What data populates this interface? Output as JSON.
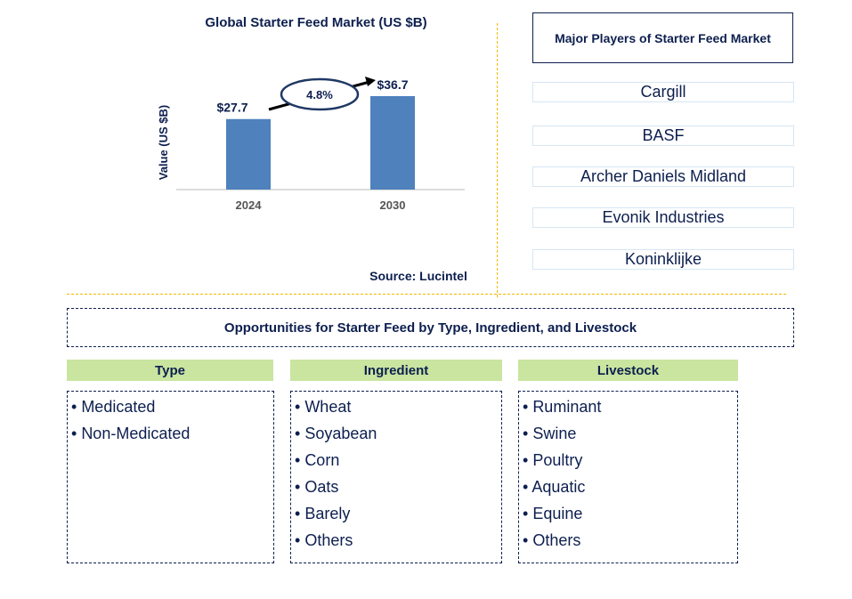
{
  "chart_data": {
    "type": "bar",
    "title": "Global Starter Feed Market (US $B)",
    "xlabel": "",
    "ylabel": "Value (US $B)",
    "categories": [
      "2024",
      "2030"
    ],
    "values": [
      27.7,
      36.7
    ],
    "data_labels": [
      "$27.7",
      "$36.7"
    ],
    "annotation": {
      "text": "4.8%",
      "meaning": "CAGR 2024-2030"
    },
    "ylim": [
      0,
      40
    ],
    "grid": false,
    "bar_color": "#4f81bd"
  },
  "source": "Source: Lucintel",
  "players": {
    "title": "Major Players of Starter Feed Market",
    "items": [
      "Cargill",
      "BASF",
      "Archer Daniels Midland",
      "Evonik Industries",
      "Koninklijke"
    ]
  },
  "opportunities": {
    "title": "Opportunities for Starter Feed by Type, Ingredient, and Livestock",
    "categories": [
      {
        "heading": "Type",
        "items": [
          "Medicated",
          "Non-Medicated"
        ]
      },
      {
        "heading": "Ingredient",
        "items": [
          "Wheat",
          "Soyabean",
          "Corn",
          "Oats",
          "Barely",
          "Others"
        ]
      },
      {
        "heading": "Livestock",
        "items": [
          "Ruminant",
          "Swine",
          "Poultry",
          "Aquatic",
          "Equine",
          "Others"
        ]
      }
    ]
  }
}
